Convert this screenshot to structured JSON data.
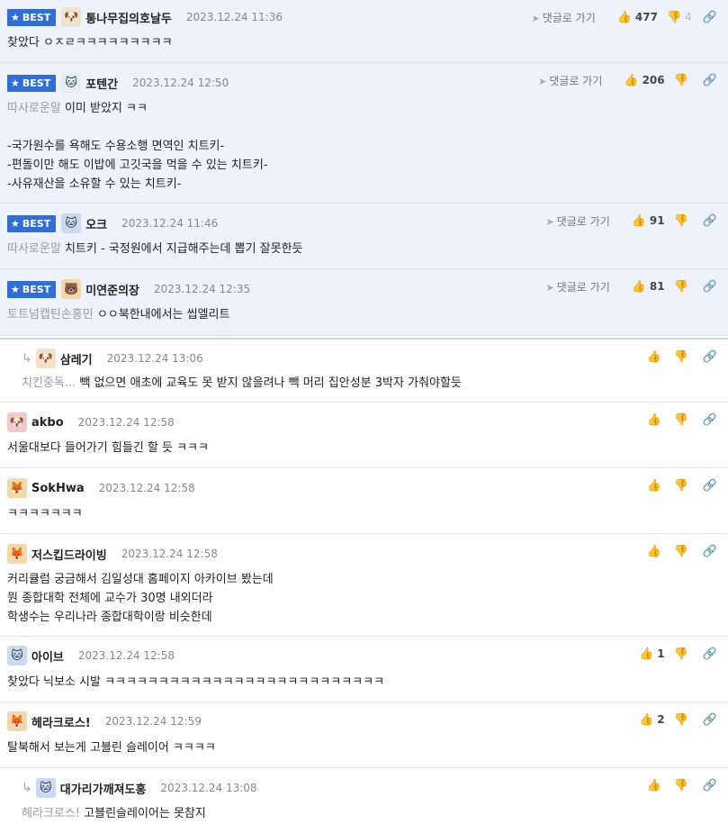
{
  "labels": {
    "best": "BEST",
    "reply_link": "댓글로 가기"
  },
  "comments": [
    {
      "nick": "통나무집의호날두",
      "date": "2023.12.24 11:36",
      "mention": "",
      "text": "찾았다 ㅇㅈㄹㅋㅋㅋㅋㅋㅋㅋㅋㅋ",
      "up": "477",
      "down": "4",
      "avatar": "shiba-avatar-icon"
    },
    {
      "nick": "포텐간",
      "date": "2023.12.24 12:50",
      "mention": "따사로운말",
      "text": " 이미 받았지 ㅋㅋ\n\n-국가원수를 욕해도 수용소행 면역인 치트키-\n-편돌이만 해도 이밥에 고깃국을 먹을 수 있는 치트키-\n-사유재산을 소유할 수 있는 치트키-",
      "up": "206",
      "down": "",
      "avatar": "white-cat-avatar-icon"
    },
    {
      "nick": "오크",
      "date": "2023.12.24 11:46",
      "mention": "따사로운말",
      "text": " 치트키 - 국정원에서 지급해주는데 뽑기 잘못한듯",
      "up": "91",
      "down": "",
      "avatar": "blue-cat-avatar-icon"
    },
    {
      "nick": "미연준의장",
      "date": "2023.12.24 12:35",
      "mention": "토트넘캡틴손흥민",
      "text": " ㅇㅇ북한내에서는 씹엘리트",
      "up": "81",
      "down": "",
      "avatar": "bear-avatar-icon"
    },
    {
      "nick": "삼레기",
      "date": "2023.12.24 13:06",
      "mention": "치킨중독...",
      "text": " 빽 없으면 애초에 교육도 못 받지 않을려나 빽 머리 집안성분 3박자 가춰야할듯",
      "up": "",
      "down": "",
      "avatar": "shiba-avatar-icon"
    },
    {
      "nick": "akbo",
      "date": "2023.12.24 12:58",
      "mention": "",
      "text": "서울대보다 들어가기 힘들긴 할 듯 ㅋㅋㅋ",
      "up": "",
      "down": "",
      "avatar": "red-dog-avatar-icon"
    },
    {
      "nick": "SokHwa",
      "date": "2023.12.24 12:58",
      "mention": "",
      "text": "ㅋㅋㅋㅋㅋㅋㅋ",
      "up": "",
      "down": "",
      "avatar": "fox-avatar-icon"
    },
    {
      "nick": "저스킵드라이빙",
      "date": "2023.12.24 12:58",
      "mention": "",
      "text": "커리큘럼 궁금해서 김일성대 홈페이지 아카이브 봤는데\n뭔 종합대학 전체에 교수가 30명 내외더라\n학생수는 우리나라 종합대학이랑 비슷한데",
      "up": "",
      "down": "",
      "avatar": "fox-avatar-icon"
    },
    {
      "nick": "아이브",
      "date": "2023.12.24 12:58",
      "mention": "",
      "text": "찾았다 닉보소 시발 ㅋㅋㅋㅋㅋㅋㅋㅋㅋㅋㅋㅋㅋㅋㅋㅋㅋㅋㅋㅋㅋㅋㅋㅋㅋㅋ",
      "up": "1",
      "down": "",
      "avatar": "blue-cat-avatar-icon"
    },
    {
      "nick": "헤라크로스!",
      "date": "2023.12.24 12:59",
      "mention": "",
      "text": "탈북해서 보는게 고블린 슬레이어 ㅋㅋㅋㅋ",
      "up": "2",
      "down": "",
      "avatar": "fox-avatar-icon"
    },
    {
      "nick": "대가리가깨져도홍",
      "date": "2023.12.24 13:08",
      "mention": "헤라크로스!",
      "text": " 고블린슬레이어는 못참지",
      "up": "",
      "down": "",
      "avatar": "blue-cat-avatar-icon"
    }
  ],
  "colors": {
    "best_badge": "#2f6ed6",
    "best_row_bg": "#eef2fc",
    "mention": "#9a9a9a"
  }
}
